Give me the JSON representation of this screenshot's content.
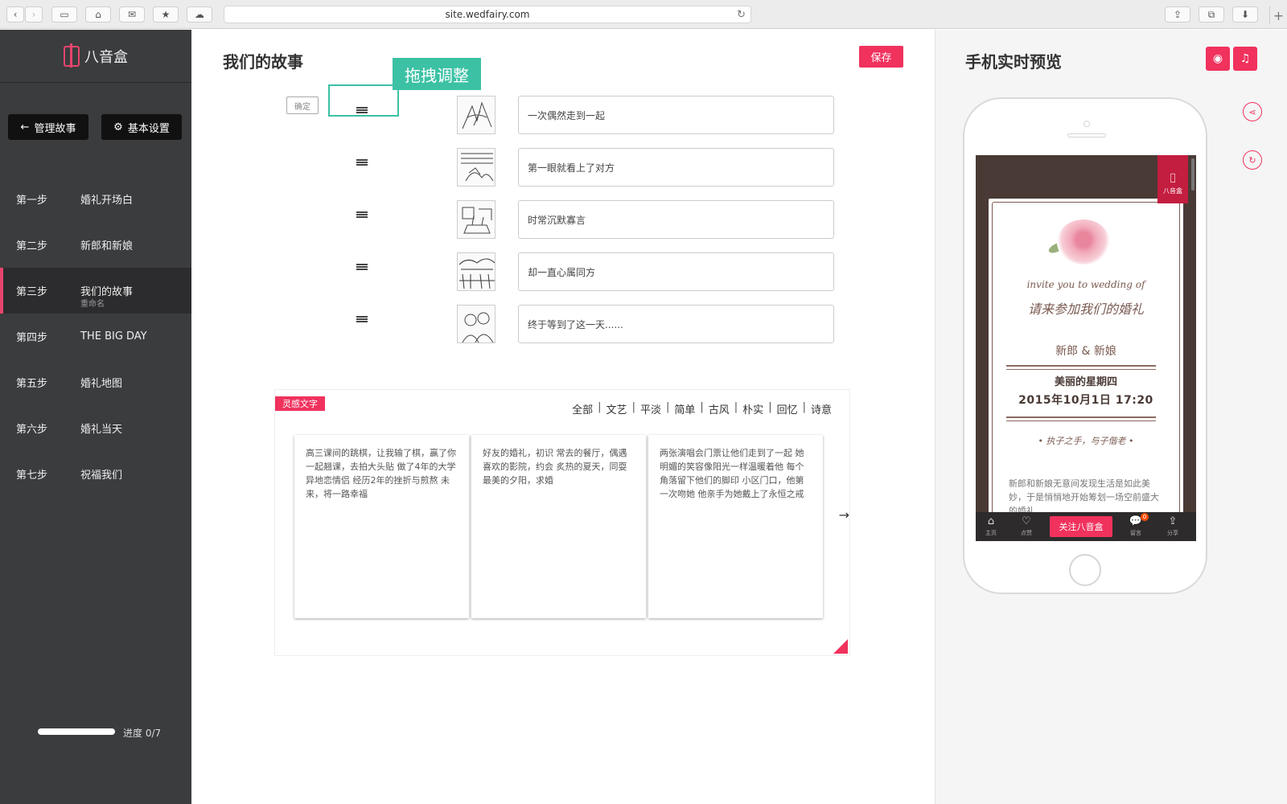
{
  "browser": {
    "url": "site.wedfairy.com"
  },
  "sidebar": {
    "logo_text": "八音盒",
    "manage_button": "管理故事",
    "settings_button": "基本设置",
    "steps": [
      {
        "num": "第一步",
        "label": "婚礼开场白"
      },
      {
        "num": "第二步",
        "label": "新郎和新娘"
      },
      {
        "num": "第三步",
        "label": "我们的故事",
        "sub": "重命名"
      },
      {
        "num": "第四步",
        "label": "THE BIG DAY"
      },
      {
        "num": "第五步",
        "label": "婚礼地图"
      },
      {
        "num": "第六步",
        "label": "婚礼当天"
      },
      {
        "num": "第七步",
        "label": "祝福我们"
      }
    ],
    "active_step": 2,
    "progress_label": "进度 0/7"
  },
  "main": {
    "title": "我们的故事",
    "save_label": "保存",
    "drag_tip": "拖拽调整",
    "confirm_label": "确定",
    "stories": [
      "一次偶然走到一起",
      "第一眼就看上了对方",
      "时常沉默寡言",
      "却一直心属同方",
      "终于等到了这一天......"
    ],
    "inspiration": {
      "tag": "灵感文字",
      "filters": [
        "全部",
        "文艺",
        "平淡",
        "简单",
        "古风",
        "朴实",
        "回忆",
        "诗意"
      ],
      "cards": [
        "高三课间的跳棋，让我输了棋，赢了你 一起翘课，去拍大头贴 做了4年的大学异地恋情侣 经历2年的挫折与煎熬 未来，将一路幸福",
        "好友的婚礼，初识 常去的餐厅，偶遇 喜欢的影院，约会 炙热的夏天，同耍 最美的夕阳，求婚",
        "两张演唱会门票让他们走到了一起 她明媚的笑容像阳光一样温暖着他 每个角落留下他们的脚印 小区门口，他第一次吻她 他亲手为她戴上了永恒之戒"
      ]
    }
  },
  "preview": {
    "title": "手机实时预览",
    "ribbon_text": "八音盒",
    "invite_en": "invite you to wedding of",
    "invite_cn": "请来参加我们的婚礼",
    "groom": "新郎",
    "amp": "&",
    "bride": "新娘",
    "weekday": "美丽的星期四",
    "datetime": "2015年10月1日 17:20",
    "quote": "• 执子之手，与子偕老 •",
    "story": "新郎和新娘无意间发现生活是如此美妙，于是悄悄地开始筹划一场空前盛大的婚礼",
    "nav": {
      "home": "主页",
      "like": "点赞",
      "follow": "关注八音盒",
      "comment": "留言",
      "comment_badge": "0",
      "share": "分享"
    }
  },
  "colors": {
    "accent": "#f0325d",
    "teal": "#3cc1a4",
    "sidebar_bg": "#3b3c3e"
  }
}
